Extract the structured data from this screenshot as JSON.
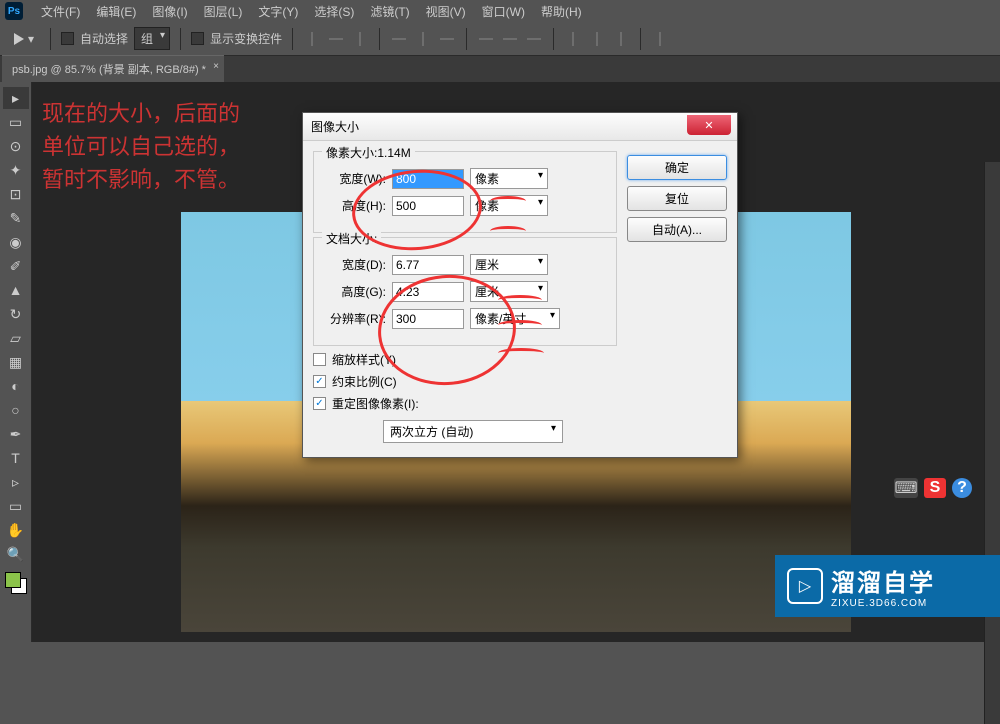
{
  "app": {
    "logo": "Ps"
  },
  "menu": {
    "items": [
      "文件(F)",
      "编辑(E)",
      "图像(I)",
      "图层(L)",
      "文字(Y)",
      "选择(S)",
      "滤镜(T)",
      "视图(V)",
      "窗口(W)",
      "帮助(H)"
    ]
  },
  "options": {
    "auto_select": "自动选择",
    "group": "组",
    "show_transform": "显示变换控件"
  },
  "tab": {
    "title": "psb.jpg @ 85.7% (背景 副本, RGB/8#) *"
  },
  "annotation": {
    "line1": "现在的大小，后面的",
    "line2": "单位可以自己选的，",
    "line3": "暂时不影响，不管。"
  },
  "dialog": {
    "title": "图像大小",
    "pixel_section": {
      "label": "像素大小:1.14M",
      "width_label": "宽度(W):",
      "width_value": "800",
      "width_unit": "像素",
      "height_label": "高度(H):",
      "height_value": "500",
      "height_unit": "像素"
    },
    "doc_section": {
      "label": "文档大小:",
      "width_label": "宽度(D):",
      "width_value": "6.77",
      "width_unit": "厘米",
      "height_label": "高度(G):",
      "height_value": "4.23",
      "height_unit": "厘米",
      "res_label": "分辨率(R):",
      "res_value": "300",
      "res_unit": "像素/英寸"
    },
    "options": {
      "scale_styles": "缩放样式(Y)",
      "constrain": "约束比例(C)",
      "resample": "重定图像像素(I):",
      "method": "两次立方 (自动)"
    },
    "buttons": {
      "ok": "确定",
      "cancel": "复位",
      "auto": "自动(A)..."
    }
  },
  "ime": {
    "s": "S",
    "q": "?"
  },
  "watermark": {
    "main": "溜溜自学",
    "sub": "ZIXUE.3D66.COM",
    "icon": "▷"
  }
}
